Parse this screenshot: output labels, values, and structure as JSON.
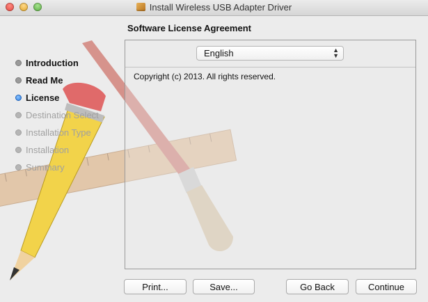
{
  "window": {
    "title": "Install Wireless USB Adapter Driver"
  },
  "heading": "Software License Agreement",
  "steps": [
    {
      "label": "Introduction",
      "state": "done"
    },
    {
      "label": "Read Me",
      "state": "done"
    },
    {
      "label": "License",
      "state": "current"
    },
    {
      "label": "Destination Select",
      "state": "pending"
    },
    {
      "label": "Installation Type",
      "state": "pending"
    },
    {
      "label": "Installation",
      "state": "pending"
    },
    {
      "label": "Summary",
      "state": "pending"
    }
  ],
  "language": {
    "selected": "English"
  },
  "license_text": "Copyright (c) 2013.  All rights reserved.",
  "buttons": {
    "print": "Print...",
    "save": "Save...",
    "go_back": "Go Back",
    "continue": "Continue"
  },
  "colors": {
    "accent": "#2f7fe0",
    "window_bg": "#ececec"
  }
}
